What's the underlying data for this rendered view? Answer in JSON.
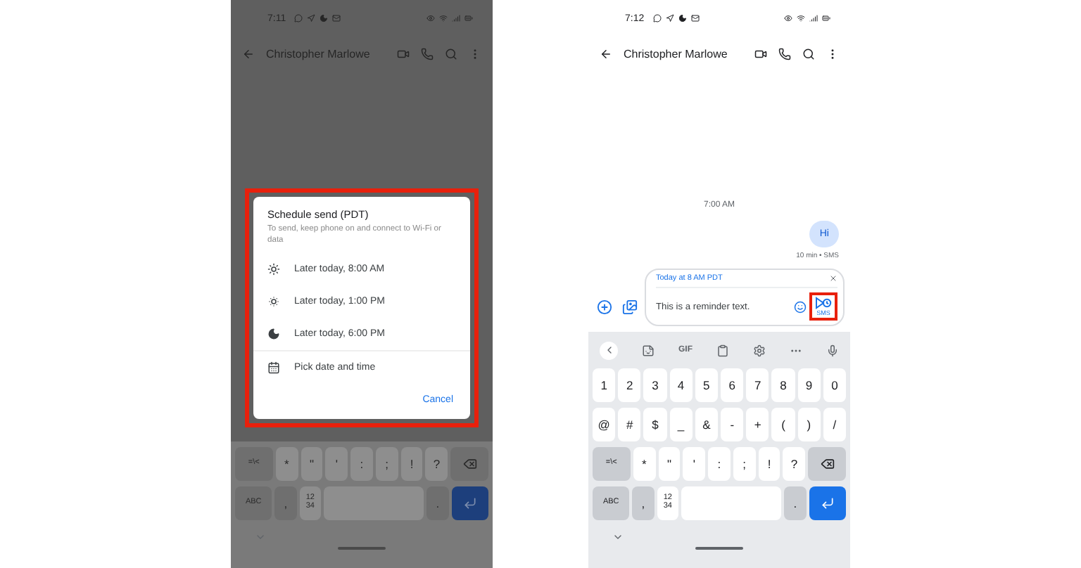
{
  "phones": [
    {
      "dimmed": true,
      "status_bar": {
        "time": "7:11"
      },
      "header": {
        "title": "Christopher Marlowe"
      },
      "dialog": {
        "highlighted": true,
        "title": "Schedule send (PDT)",
        "subtitle": "To send, keep phone on and connect to Wi-Fi or data",
        "options": [
          {
            "label": "Later today, 8:00 AM"
          },
          {
            "label": "Later today, 1:00 PM"
          },
          {
            "label": "Later today, 6:00 PM"
          }
        ],
        "pick": {
          "label": "Pick date and time"
        },
        "cancel": "Cancel"
      },
      "keyboard": {
        "rows": [
          {
            "keys": [
              {
                "kind": "fn",
                "label": "=\\<"
              },
              {
                "kind": "char",
                "label": "*"
              },
              {
                "kind": "char",
                "label": "\""
              },
              {
                "kind": "char",
                "label": "'"
              },
              {
                "kind": "char",
                "label": ":"
              },
              {
                "kind": "char",
                "label": ";"
              },
              {
                "kind": "char",
                "label": "!"
              },
              {
                "kind": "char",
                "label": "?"
              },
              {
                "kind": "backspace"
              }
            ]
          },
          {
            "keys": [
              {
                "kind": "fn",
                "label": "ABC"
              },
              {
                "kind": "fn",
                "label": ","
              },
              {
                "kind": "stack",
                "lines": [
                  "12",
                  "34"
                ]
              },
              {
                "kind": "space"
              },
              {
                "kind": "fn",
                "label": "."
              },
              {
                "kind": "enter"
              }
            ]
          }
        ]
      }
    },
    {
      "dimmed": false,
      "status_bar": {
        "time": "7:12"
      },
      "header": {
        "title": "Christopher Marlowe"
      },
      "conversation": {
        "timestamp": "7:00 AM",
        "messages": [
          {
            "text": "Hi",
            "meta": "10 min • SMS"
          }
        ]
      },
      "compose": {
        "banner": "Today at 8 AM PDT",
        "text": "This is a reminder text.",
        "send": {
          "label": "SMS",
          "highlighted": true
        }
      },
      "keyboard": {
        "toolbar": [
          {
            "kind": "icon"
          },
          {
            "kind": "icon"
          },
          {
            "kind": "text",
            "label": "GIF"
          },
          {
            "kind": "icon"
          },
          {
            "kind": "icon"
          },
          {
            "kind": "icon"
          },
          {
            "kind": "icon"
          }
        ],
        "rows": [
          {
            "keys": [
              {
                "kind": "char",
                "label": "1"
              },
              {
                "kind": "char",
                "label": "2"
              },
              {
                "kind": "char",
                "label": "3"
              },
              {
                "kind": "char",
                "label": "4"
              },
              {
                "kind": "char",
                "label": "5"
              },
              {
                "kind": "char",
                "label": "6"
              },
              {
                "kind": "char",
                "label": "7"
              },
              {
                "kind": "char",
                "label": "8"
              },
              {
                "kind": "char",
                "label": "9"
              },
              {
                "kind": "char",
                "label": "0"
              }
            ]
          },
          {
            "keys": [
              {
                "kind": "char",
                "label": "@"
              },
              {
                "kind": "char",
                "label": "#"
              },
              {
                "kind": "char",
                "label": "$"
              },
              {
                "kind": "char",
                "label": "_"
              },
              {
                "kind": "char",
                "label": "&"
              },
              {
                "kind": "char",
                "label": "-"
              },
              {
                "kind": "char",
                "label": "+"
              },
              {
                "kind": "char",
                "label": "("
              },
              {
                "kind": "char",
                "label": ")"
              },
              {
                "kind": "char",
                "label": "/"
              }
            ]
          },
          {
            "keys": [
              {
                "kind": "fn",
                "label": "=\\<"
              },
              {
                "kind": "char",
                "label": "*"
              },
              {
                "kind": "char",
                "label": "\""
              },
              {
                "kind": "char",
                "label": "'"
              },
              {
                "kind": "char",
                "label": ":"
              },
              {
                "kind": "char",
                "label": ";"
              },
              {
                "kind": "char",
                "label": "!"
              },
              {
                "kind": "char",
                "label": "?"
              },
              {
                "kind": "backspace"
              }
            ]
          },
          {
            "keys": [
              {
                "kind": "fn",
                "label": "ABC"
              },
              {
                "kind": "fn",
                "label": ","
              },
              {
                "kind": "stack",
                "lines": [
                  "12",
                  "34"
                ]
              },
              {
                "kind": "space"
              },
              {
                "kind": "fn",
                "label": "."
              },
              {
                "kind": "enter"
              }
            ]
          }
        ]
      }
    }
  ]
}
